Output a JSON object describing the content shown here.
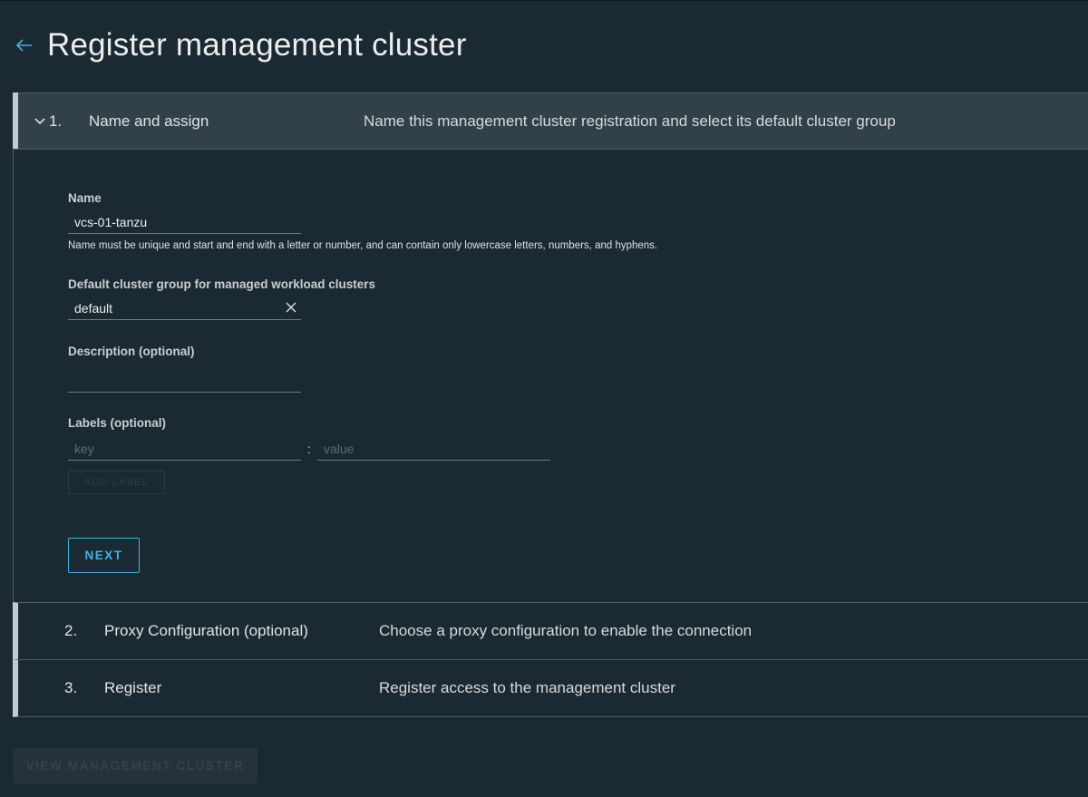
{
  "header": {
    "title": "Register management cluster",
    "back_icon": "arrow-left-icon"
  },
  "steps": [
    {
      "number": "1.",
      "title": "Name and assign",
      "description": "Name this management cluster registration and select its default cluster group",
      "expanded": true
    },
    {
      "number": "2.",
      "title": "Proxy Configuration (optional)",
      "description": "Choose a proxy configuration to enable the connection",
      "expanded": false
    },
    {
      "number": "3.",
      "title": "Register",
      "description": "Register access to the management cluster",
      "expanded": false
    }
  ],
  "form": {
    "name_label": "Name",
    "name_value": "vcs-01-tanzu",
    "name_helper": "Name must be unique and start and end with a letter or number, and can contain only lowercase letters, numbers, and hyphens.",
    "group_label": "Default cluster group for managed workload clusters",
    "group_value": "default",
    "description_label": "Description (optional)",
    "description_value": "",
    "labels_label": "Labels (optional)",
    "key_placeholder": "key",
    "value_placeholder": "value",
    "colon": ":",
    "add_label_button": "ADD LABEL",
    "next_button": "NEXT"
  },
  "footer": {
    "view_button": "VIEW MANAGEMENT CLUSTER"
  },
  "colors": {
    "accent": "#49aee3",
    "background": "#1b2a32",
    "active_step": "#324049"
  }
}
